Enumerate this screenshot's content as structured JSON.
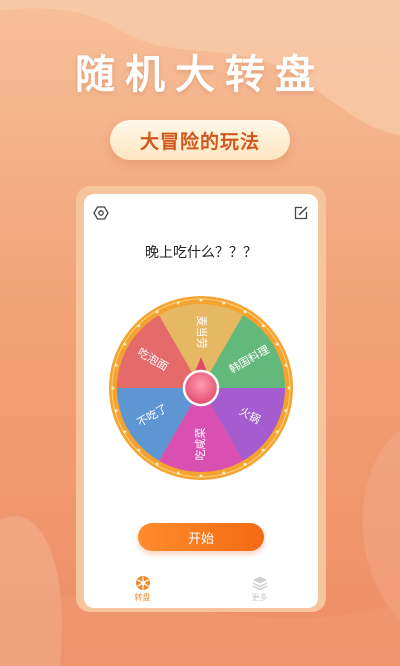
{
  "hero": {
    "title": "随机大转盘",
    "subtitle": "大冒险的玩法"
  },
  "card": {
    "question": "晚上吃什么？？？",
    "start_label": "开始"
  },
  "wheel": {
    "segments": [
      {
        "label": "麦当劳",
        "color": "#e7b864"
      },
      {
        "label": "韩国料理",
        "color": "#62b97b"
      },
      {
        "label": "火锅",
        "color": "#a45ccf"
      },
      {
        "label": "吃咸菜",
        "color": "#d94fb2"
      },
      {
        "label": "不吃了",
        "color": "#5d96d3"
      },
      {
        "label": "吃泡面",
        "color": "#e56a6a"
      }
    ]
  },
  "tabs": [
    {
      "label": "转盘",
      "icon": "wheel-icon",
      "active": true
    },
    {
      "label": "更多",
      "icon": "layers-icon",
      "active": false
    }
  ],
  "colors": {
    "accent": "#f36a13",
    "wheel_rim": "#f4a330"
  }
}
